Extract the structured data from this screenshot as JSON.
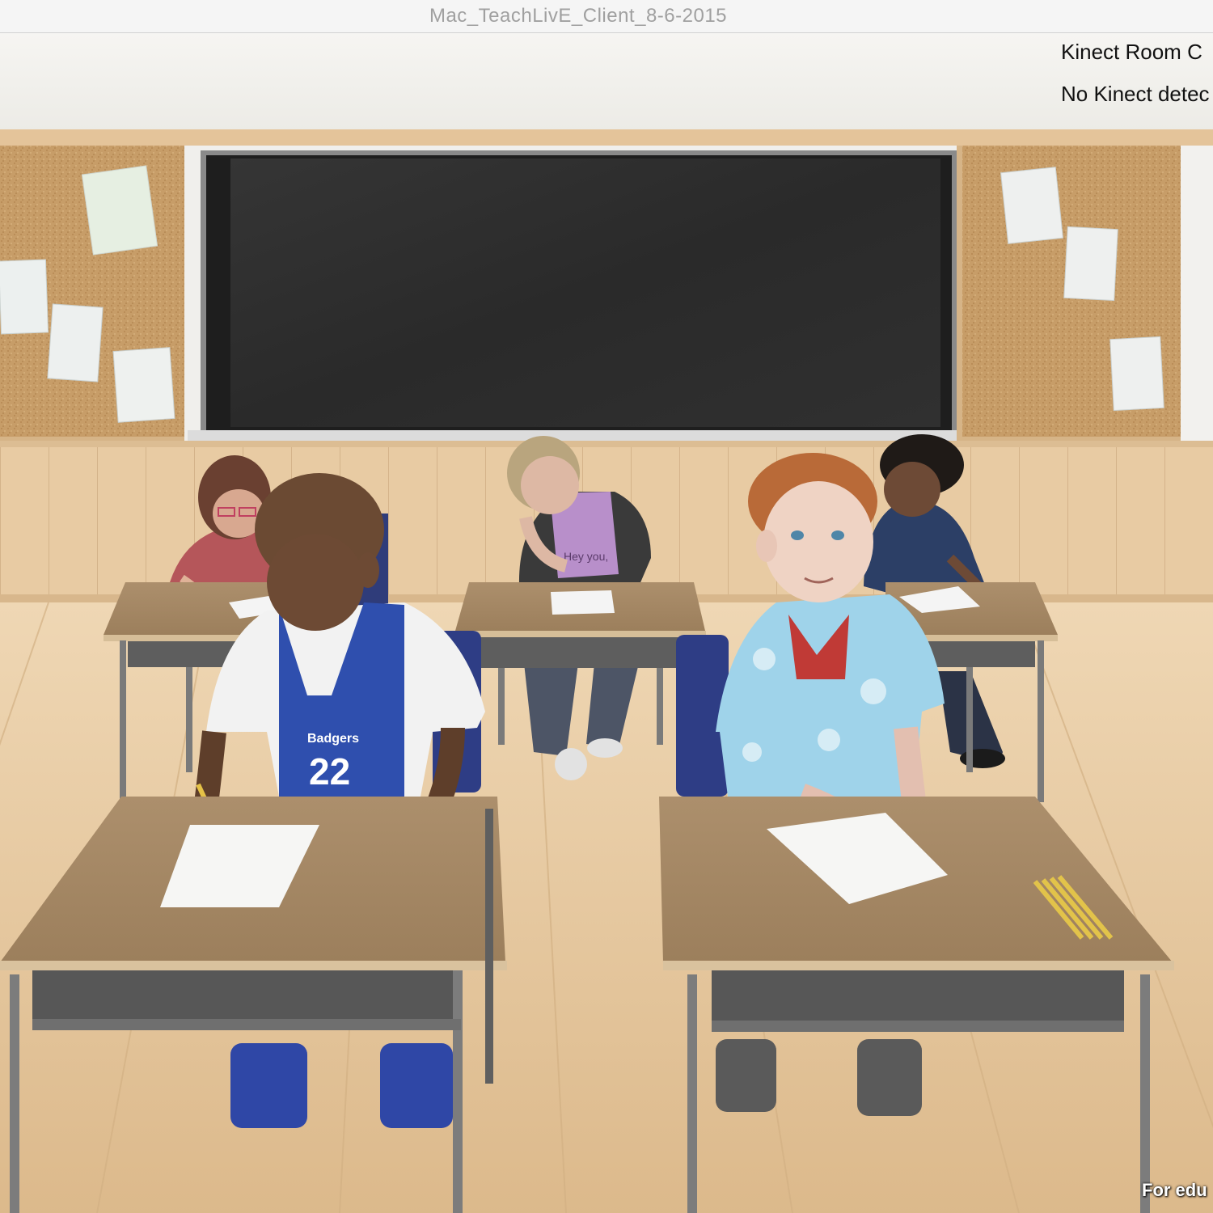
{
  "window": {
    "title": "Mac_TeachLivE_Client_8-6-2015"
  },
  "overlay": {
    "status_line": "Kinect Room C",
    "kinect_line": "No Kinect detec",
    "watermark": "For edu"
  },
  "scene": {
    "jersey_team": "Badgers",
    "jersey_number": "22",
    "shirt_text": "Hey you,"
  },
  "colors": {
    "wall": "#f3f2ee",
    "chalkboard": "#2c2c2c",
    "corkboard": "#c49a64",
    "wainscot": "#e5c9a3",
    "floor": "#e3c39a",
    "desk_top": "#a88b67",
    "jersey_blue": "#2f4fae",
    "shirt_light_blue": "#9fd3ea"
  }
}
